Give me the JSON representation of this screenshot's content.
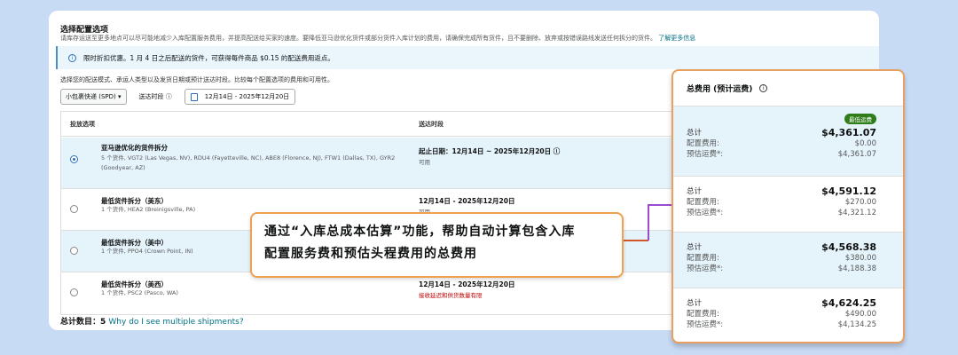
{
  "header": {
    "title": "选择配置选项",
    "description": "请库存运送至更多地点可以尽可能地减少入库配置服务费用，并提高配送给买家的速度。要降低亚马逊优化货件或部分货件入库计划的费用，请确保完成所有货件，且不要删除、放弃或按错误路线发送任何拆分的货件。",
    "learn_more": "了解更多信息"
  },
  "notice": {
    "text": "限时折扣优惠。1 月 4 日之后配送的货件，可获得每件商品 $0.15 的配送费用返点。"
  },
  "instructions": "选择您的配送模式、承运人类型以及发货日期或预计送达时段。比较每个配置选项的费用和可用性。",
  "controls": {
    "mode": "小包裹快递 (SPD)",
    "window_label": "送达时段",
    "date_range": "12月14日 - 2025年12月20日"
  },
  "table": {
    "headers": [
      "投放选项",
      "送达时段"
    ],
    "rows": [
      {
        "name": "亚马逊优化的货件拆分",
        "detail": "5 个货件, VGT2 (Las Vegas, NV), RDU4 (Fayetteville, NC), ABE8 (Florence, NJ), FTW1 (Dallas, TX), GYR2 (Goodyear, AZ)",
        "date": "起止日期：12月14日 ~ 2025年12月20日 ⓘ",
        "status": "可用",
        "selected": true
      },
      {
        "name": "最低货件拆分（美东）",
        "detail": "1 个货件, HEA2 (Breinigsville, PA)",
        "date": "12月14日 - 2025年12月20日",
        "status": "可用",
        "selected": false
      },
      {
        "name": "最低货件拆分（美中）",
        "detail": "1 个货件, PPO4 (Crown Point, IN)",
        "date": "",
        "status": "",
        "selected": false
      },
      {
        "name": "最低货件拆分（美西）",
        "detail": "1 个货件, PSC2 (Pasco, WA)",
        "date": "12月14日 - 2025年12月20日",
        "status": "接收延迟和供货数量有限",
        "selected": false
      }
    ]
  },
  "footer": {
    "label": "总计数目：5",
    "link": "Why do I see multiple shipments?"
  },
  "callout": {
    "line1": "通过“入库总成本估算”功能，帮助自动计算包含入库",
    "line2": "配置服务费和预估头程费用的总费用"
  },
  "cost_panel": {
    "title": "总费用 (预计运费)",
    "badge": "最低运费",
    "labels": {
      "total": "总计",
      "placement": "配置费用:",
      "shipping": "预估运费*:"
    },
    "rows": [
      {
        "total": "$4,361.07",
        "placement": "$0.00",
        "shipping": "$4,361.07"
      },
      {
        "total": "$4,591.12",
        "placement": "$270.00",
        "shipping": "$4,321.12"
      },
      {
        "total": "$4,568.38",
        "placement": "$380.00",
        "shipping": "$4,188.38"
      },
      {
        "total": "$4,624.25",
        "placement": "$490.00",
        "shipping": "$4,134.25"
      }
    ]
  }
}
